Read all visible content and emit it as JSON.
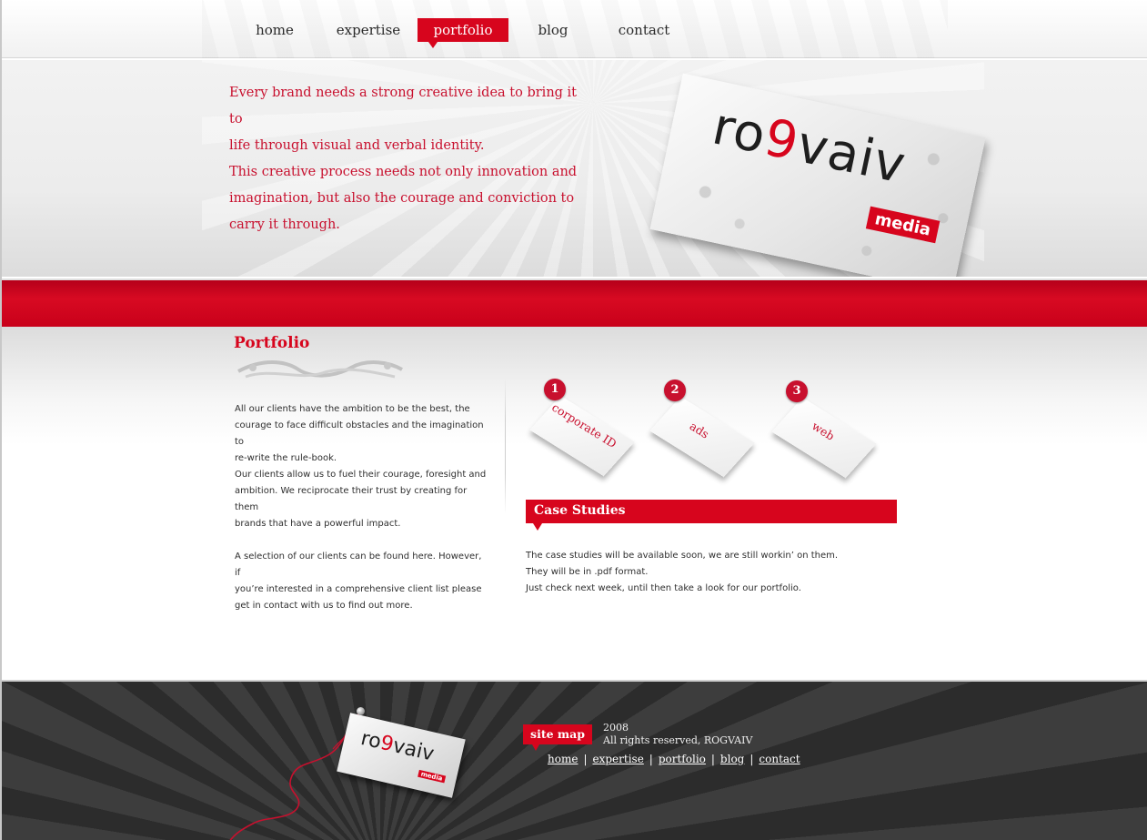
{
  "nav": {
    "items": [
      {
        "label": "home",
        "active": false
      },
      {
        "label": "expertise",
        "active": false
      },
      {
        "label": "portfolio",
        "active": true
      },
      {
        "label": "blog",
        "active": false
      },
      {
        "label": "contact",
        "active": false
      }
    ]
  },
  "hero": {
    "lines": [
      "Every brand needs a strong creative idea to bring it to",
      "life through visual and verbal identity.",
      "This creative process needs not only innovation and",
      "imagination, but also the courage and conviction to",
      "carry it through."
    ],
    "logo": {
      "word_part1": "ro",
      "word_accent": "9",
      "word_part2": "vaiv",
      "sub": "media"
    }
  },
  "portfolio": {
    "title": "Portfolio",
    "paragraph1": [
      "All our clients have the ambition to be the best, the",
      "courage to face difficult obstacles and the imagination to",
      "re-write the rule-book.",
      "Our clients allow us to fuel their courage, foresight and",
      "ambition. We reciprocate their trust by creating for them",
      "brands that have a powerful impact."
    ],
    "paragraph2": [
      "A selection of our clients can be found here. However, if",
      "you’re interested in a comprehensive client list please",
      "get in contact with us to find out more."
    ],
    "tags": [
      {
        "number": "1",
        "label": "corporate ID"
      },
      {
        "number": "2",
        "label": "ads"
      },
      {
        "number": "3",
        "label": "web"
      }
    ]
  },
  "case_studies": {
    "title": "Case Studies",
    "lines": [
      "The case studies will be available soon, we are still workin’ on them.",
      "They will be in .pdf format.",
      "Just check next week, until then take a look for our portfolio."
    ]
  },
  "footer": {
    "sitemap_label": "site map",
    "year": "2008",
    "rights": "All rights reserved, ROGVAIV",
    "links": [
      "home",
      "expertise",
      "portfolio",
      "blog",
      "contact"
    ],
    "logo": {
      "word_part1": "ro",
      "word_accent": "9",
      "word_part2": "vaiv",
      "sub": "media"
    }
  },
  "colors": {
    "accent": "#d7051d",
    "footer_bg": "#3d3d3d"
  }
}
